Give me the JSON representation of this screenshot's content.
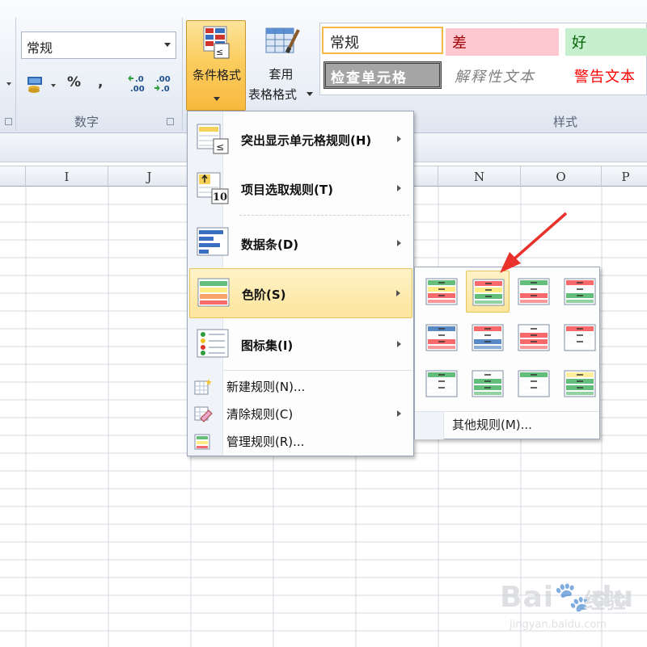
{
  "ribbon": {
    "number_format": "常规",
    "percent_symbol": "%",
    "comma_symbol": ",",
    "increase_decimal": ".0 .00",
    "decrease_decimal": ".00 .0",
    "number_group_label": "数字",
    "conditional_format_label": "条件格式",
    "table_format_label_1": "套用",
    "table_format_label_2": "表格格式",
    "styles_group_label": "样式",
    "styles": {
      "normal": "常规",
      "bad": "差",
      "good": "好",
      "check_cell": "检查单元格",
      "explanatory": "解释性文本",
      "warning": "警告文本"
    }
  },
  "columns": [
    "I",
    "J",
    "N",
    "O",
    "P"
  ],
  "cf_menu": {
    "items": [
      {
        "label": "突出显示单元格规则(H)"
      },
      {
        "label": "项目选取规则(T)"
      },
      {
        "label": "数据条(D)"
      },
      {
        "label": "色阶(S)"
      },
      {
        "label": "图标集(I)"
      }
    ],
    "small_items": [
      {
        "label": "新建规则(N)..."
      },
      {
        "label": "清除规则(C)"
      },
      {
        "label": "管理规则(R)..."
      }
    ]
  },
  "color_scale_menu": {
    "swatches": [
      {
        "colors": [
          "#63be7b",
          "#ffeb84",
          "#f8696b"
        ]
      },
      {
        "colors": [
          "#f8696b",
          "#ffeb84",
          "#63be7b"
        ]
      },
      {
        "colors": [
          "#63be7b",
          "#fcfcff",
          "#f8696b"
        ]
      },
      {
        "colors": [
          "#f8696b",
          "#fcfcff",
          "#63be7b"
        ]
      },
      {
        "colors": [
          "#5a8ac6",
          "#fcfcff",
          "#f8696b"
        ]
      },
      {
        "colors": [
          "#f8696b",
          "#fcfcff",
          "#5a8ac6"
        ]
      },
      {
        "colors": [
          "#fcfcff",
          "#f8696b",
          "#f8696b"
        ]
      },
      {
        "colors": [
          "#f8696b",
          "#fcfcff",
          "#fcfcff"
        ]
      },
      {
        "colors": [
          "#63be7b",
          "#fcfcff",
          "#fcfcff"
        ]
      },
      {
        "colors": [
          "#fcfcff",
          "#63be7b",
          "#63be7b"
        ]
      },
      {
        "colors": [
          "#63be7b",
          "#fcfcff",
          "#fcfcff"
        ]
      },
      {
        "colors": [
          "#ffef9c",
          "#63be7b",
          "#63be7b"
        ]
      }
    ],
    "selected_index": 1,
    "other_rules": "其他规则(M)..."
  },
  "watermark": {
    "brand": "Bai",
    "brand2": "du",
    "jingyan": "经验",
    "url": "jingyan.baidu.com"
  },
  "colors": {
    "accent_orange": "#f7b93e",
    "menu_hover": "#fde59c",
    "annotation_red": "#e8322b"
  }
}
